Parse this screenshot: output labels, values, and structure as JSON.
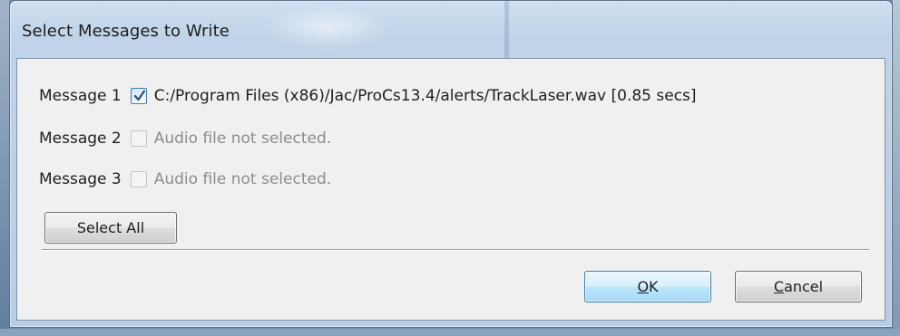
{
  "window": {
    "title": "Select Messages to Write"
  },
  "messages": [
    {
      "label": "Message 1",
      "checked": true,
      "enabled": true,
      "file": "C:/Program Files (x86)/Jac/ProCs13.4/alerts/TrackLaser.wav [0.85 secs]"
    },
    {
      "label": "Message 2",
      "checked": false,
      "enabled": false,
      "file": "Audio file not selected."
    },
    {
      "label": "Message 3",
      "checked": false,
      "enabled": false,
      "file": "Audio file not selected."
    }
  ],
  "buttons": {
    "select_all": "Select All",
    "ok_mnemonic": "O",
    "ok_rest": "K",
    "cancel_mnemonic": "C",
    "cancel_rest": "ancel"
  },
  "colors": {
    "default_button_border": "#3c7fb1",
    "disabled_text": "#8d8d8d"
  },
  "icons": {
    "checkbox_checked": "check-icon"
  }
}
